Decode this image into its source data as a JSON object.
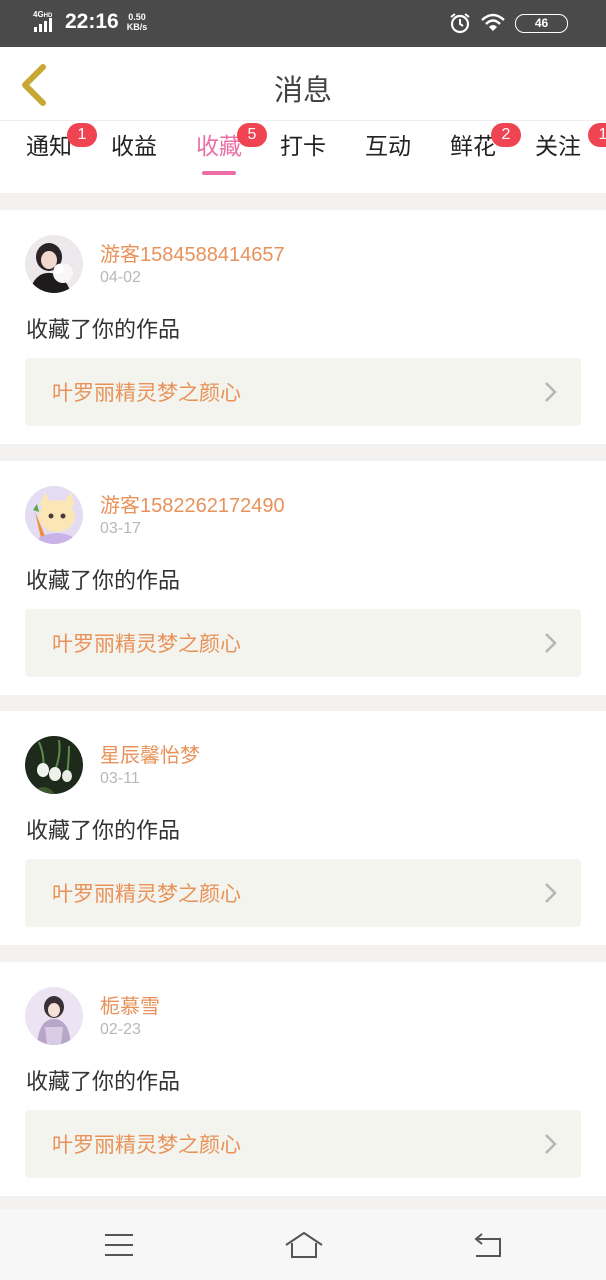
{
  "status_bar": {
    "network": "4G",
    "network_hd": "HD",
    "time": "22:16",
    "speed_value": "0.50",
    "speed_unit": "KB/s",
    "battery": "46"
  },
  "header": {
    "title": "消息",
    "back_icon": "chevron-left-icon"
  },
  "tabs": [
    {
      "label": "通知",
      "badge": "1",
      "active": false
    },
    {
      "label": "收益",
      "badge": "",
      "active": false
    },
    {
      "label": "收藏",
      "badge": "5",
      "active": true
    },
    {
      "label": "打卡",
      "badge": "",
      "active": false
    },
    {
      "label": "互动",
      "badge": "",
      "active": false
    },
    {
      "label": "鲜花",
      "badge": "2",
      "active": false
    },
    {
      "label": "关注",
      "badge": "1",
      "active": false
    }
  ],
  "messages": [
    {
      "username": "游客1584588414657",
      "date": "04-02",
      "action": "收藏了你的作品",
      "work_title": "叶罗丽精灵梦之颜心"
    },
    {
      "username": "游客1582262172490",
      "date": "03-17",
      "action": "收藏了你的作品",
      "work_title": "叶罗丽精灵梦之颜心"
    },
    {
      "username": "星辰馨怡梦",
      "date": "03-11",
      "action": "收藏了你的作品",
      "work_title": "叶罗丽精灵梦之颜心"
    },
    {
      "username": "栀慕雪",
      "date": "02-23",
      "action": "收藏了你的作品",
      "work_title": "叶罗丽精灵梦之颜心"
    }
  ],
  "colors": {
    "accent_pink": "#e96fa6",
    "username_orange": "#e8925a",
    "badge_red": "#f04452",
    "back_arrow": "#c8a832"
  },
  "bottom_nav": [
    "menu-icon",
    "home-icon",
    "back-icon"
  ]
}
